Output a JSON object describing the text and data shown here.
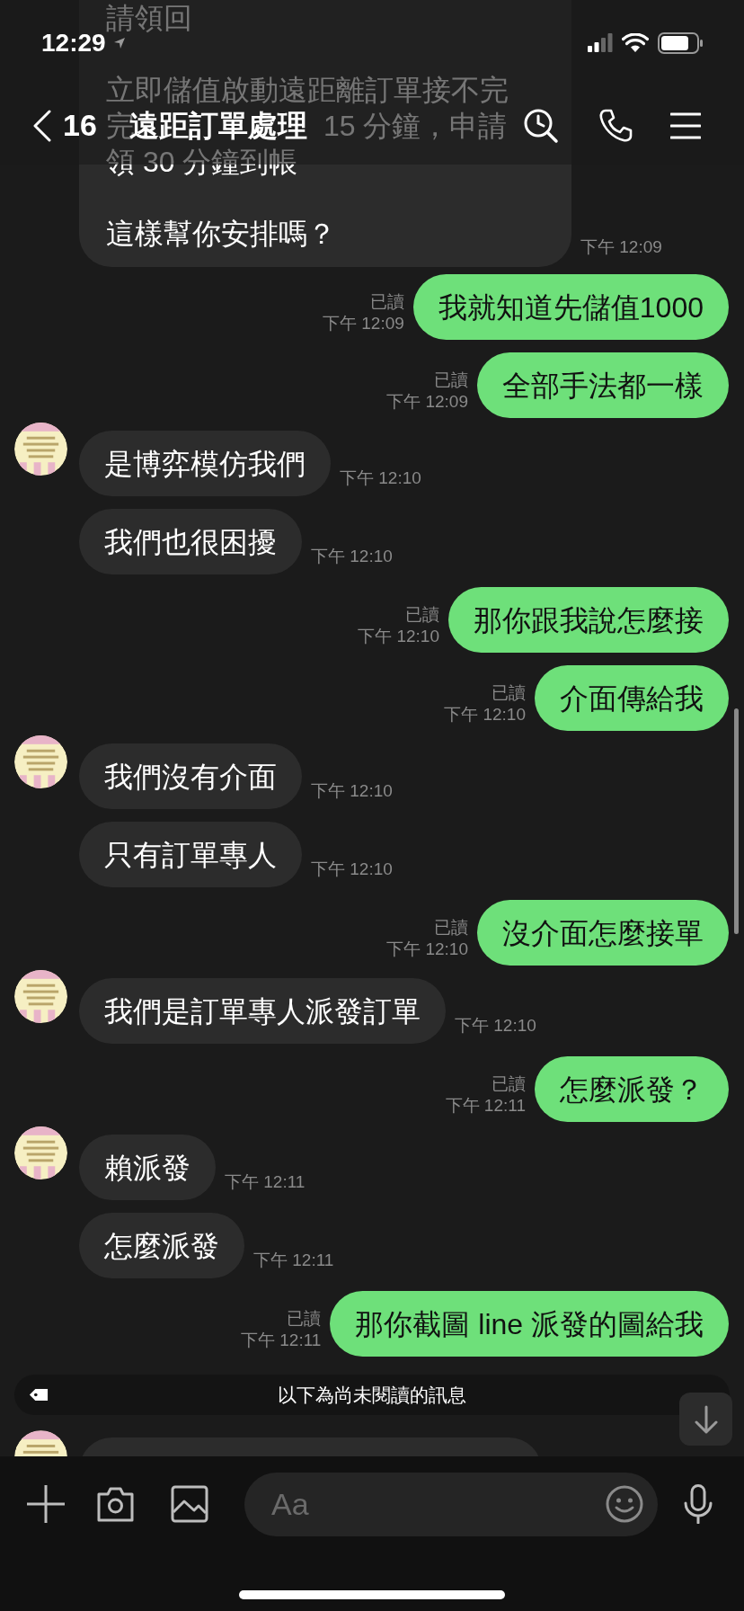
{
  "status_bar": {
    "time": "12:29"
  },
  "header": {
    "back_count": "16",
    "title": "遠距訂單處理"
  },
  "messages": [
    {
      "kind": "continued",
      "paragraphs": [
        [
          [
            "請領回"
          ]
        ],
        [
          [
            "立即儲值啟動遠距離訂單接不完"
          ],
          [
            "完",
            "15 分鐘，申請"
          ],
          [
            "領 30 分鐘到帳"
          ]
        ],
        [
          [
            "這樣幫你安排嗎？"
          ]
        ]
      ],
      "time": "下午 12:09"
    },
    {
      "kind": "sent",
      "text": "我就知道先儲值1000",
      "read_label": "已讀",
      "time": "下午 12:09"
    },
    {
      "kind": "sent",
      "text": "全部手法都一樣",
      "read_label": "已讀",
      "time": "下午 12:09"
    },
    {
      "kind": "received",
      "avatar": true,
      "text": "是博弈模仿我們",
      "time": "下午 12:10"
    },
    {
      "kind": "received",
      "avatar": false,
      "text": "我們也很困擾",
      "time": "下午 12:10"
    },
    {
      "kind": "sent",
      "text": "那你跟我說怎麼接",
      "read_label": "已讀",
      "time": "下午 12:10"
    },
    {
      "kind": "sent",
      "text": "介面傳給我",
      "read_label": "已讀",
      "time": "下午 12:10"
    },
    {
      "kind": "received",
      "avatar": true,
      "text": "我們沒有介面",
      "time": "下午 12:10"
    },
    {
      "kind": "received",
      "avatar": false,
      "text": "只有訂單專人",
      "time": "下午 12:10"
    },
    {
      "kind": "sent",
      "text": "沒介面怎麼接單",
      "read_label": "已讀",
      "time": "下午 12:10"
    },
    {
      "kind": "received",
      "avatar": true,
      "text": "我們是訂單專人派發訂單",
      "time": "下午 12:10"
    },
    {
      "kind": "sent",
      "text": "怎麼派發？",
      "read_label": "已讀",
      "time": "下午 12:11"
    },
    {
      "kind": "received",
      "avatar": true,
      "text": "賴派發",
      "time": "下午 12:11"
    },
    {
      "kind": "received",
      "avatar": false,
      "text": "怎麼派發",
      "time": "下午 12:11"
    },
    {
      "kind": "sent",
      "text": "那你截圖 line 派發的圖給我",
      "read_label": "已讀",
      "time": "下午 12:11"
    },
    {
      "kind": "divider",
      "text": "以下為尚未閱讀的訊息"
    },
    {
      "kind": "cut_off",
      "avatar": true
    }
  ],
  "composer": {
    "placeholder": "Aa"
  }
}
